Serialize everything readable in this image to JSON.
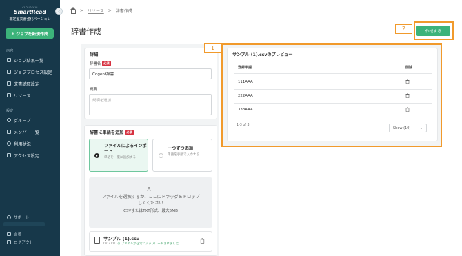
{
  "sidebar": {
    "logo_small": "CLOUDSCAI",
    "logo_main": "SmartRead",
    "logo_sub": "非定型文書強化バージョン",
    "new_job_label": "+ ジョブを新規作成",
    "section_content": "内容",
    "items_content": [
      {
        "label": "ジョブ結果一覧",
        "icon": "list-icon"
      },
      {
        "label": "ジョブプロセス設定",
        "icon": "settings-list-icon"
      },
      {
        "label": "文書読取設定",
        "icon": "document-icon"
      },
      {
        "label": "リソース",
        "icon": "resource-icon"
      }
    ],
    "section_settings": "設定",
    "items_settings": [
      {
        "label": "グループ",
        "icon": "group-icon"
      },
      {
        "label": "メンバー一覧",
        "icon": "members-icon"
      },
      {
        "label": "利用状況",
        "icon": "usage-icon"
      },
      {
        "label": "アクセス設定",
        "icon": "access-icon"
      }
    ],
    "support_label": "サポート",
    "language_label": "言語",
    "logout_label": "ログアウト"
  },
  "breadcrumb": {
    "resources": "リソース",
    "current": "辞書作成"
  },
  "page_title": "辞書作成",
  "create_button": "作成する",
  "markers": {
    "one": "1",
    "two": "2"
  },
  "details": {
    "title": "詳細",
    "name_label": "辞書名",
    "required": "必須",
    "name_value": "Cogent辞書",
    "summary_label": "概要",
    "summary_placeholder": "説明を追加..."
  },
  "add_words": {
    "title": "辞書に単語を追加",
    "required": "必須",
    "option_file_title": "ファイルによるインポート",
    "option_file_desc": "単語を一度に追加する",
    "option_manual_title": "一つずつ追加",
    "option_manual_desc": "単語を手動で入力する",
    "drop_line1": "ファイルを選択するか、ここにドラッグ＆ドロップ",
    "drop_line2": "してください",
    "drop_line3": "CSVまたはTXT形式、最大5MB",
    "file_name": "サンプル (1).csv",
    "file_size": "0.03 KB",
    "file_status": "ファイルが正常にアップロードされました"
  },
  "preview": {
    "title": "サンプル (1).csvのプレビュー",
    "col_word": "登録単語",
    "col_delete": "削除",
    "rows": [
      "111AAA",
      "222AAA",
      "333AAA"
    ],
    "pager": "1-3 of 3",
    "show_select": "Show (10)"
  },
  "colors": {
    "sidebar": "#17384a",
    "accent": "#3cb37a",
    "highlight": "#f19a2c",
    "required": "#d6303f"
  }
}
